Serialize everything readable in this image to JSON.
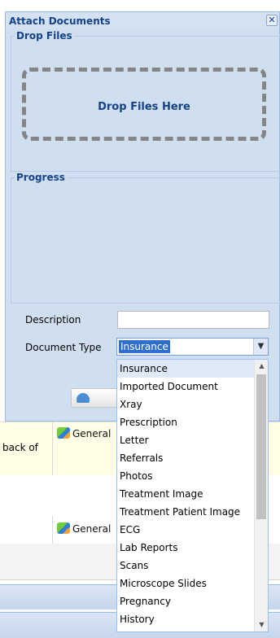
{
  "dialog": {
    "title": "Attach Documents",
    "close_icon": "close-icon",
    "drop_files_legend": "Drop Files",
    "drop_zone_text": "Drop Files Here",
    "progress_legend": "Progress",
    "description_label": "Description",
    "description_value": "",
    "document_type_label": "Document Type",
    "document_type_value": "Insurance"
  },
  "dropdown": {
    "options": [
      "Insurance",
      "Imported Document",
      "Xray",
      "Prescription",
      "Letter",
      "Referrals",
      "Photos",
      "Treatment Image",
      "Treatment Patient Image",
      "ECG",
      "Lab Reports",
      "Scans",
      "Microscope Slides",
      "Pregnancy",
      "History"
    ],
    "selected": "Insurance"
  },
  "background": {
    "row1_left_text": "back of",
    "row1_category": "General",
    "row2_category": "General",
    "category_icon": "document-category-icon"
  }
}
